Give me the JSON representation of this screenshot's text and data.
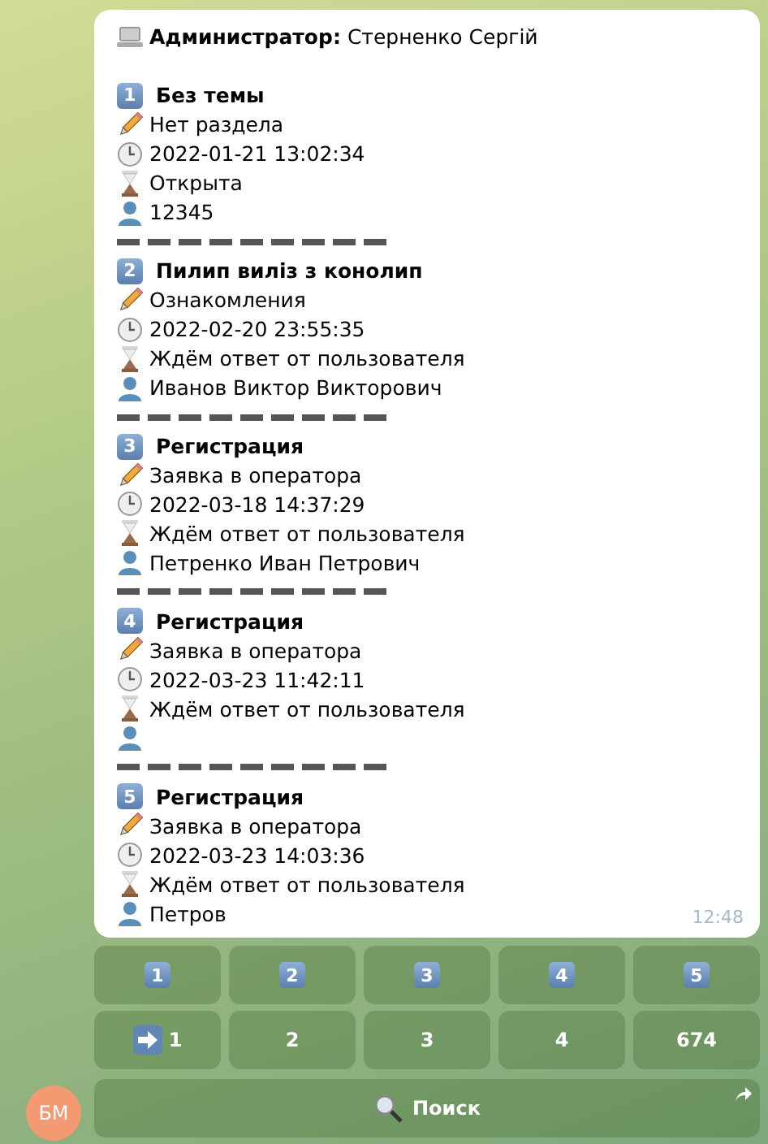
{
  "message": {
    "header": "**Администратор:** Стерненко Сергій",
    "time": "12:48",
    "tickets": [
      {
        "number": "1",
        "title": "Без темы",
        "section": "Нет раздела",
        "date": "2022-01-21 13:02:34",
        "status": "Открыта",
        "user": "12345"
      },
      {
        "number": "2",
        "title": "Пилип виліз з конолип",
        "section": "Ознакомления",
        "date": "2022-02-20 23:55:35",
        "status": "Ждём ответ от пользователя",
        "user": "Иванов Виктор Викторович"
      },
      {
        "number": "3",
        "title": "Регистрация",
        "section": "Заявка в оператора",
        "date": "2022-03-18 14:37:29",
        "status": "Ждём ответ от пользователя",
        "user": "Петренко Иван Петрович"
      },
      {
        "number": "4",
        "title": "Регистрация",
        "section": "Заявка в оператора",
        "date": "2022-03-23 11:42:11",
        "status": "Ждём ответ от пользователя"
      },
      {
        "number": "5",
        "title": "Регистрация",
        "section": "Заявка в оператора",
        "date": "2022-03-23 14:03:36",
        "status": "Ждём ответ от пользователя",
        "user": "Петров"
      }
    ]
  },
  "keyboard": {
    "ticket_buttons": [
      "1",
      "2",
      "3",
      "4",
      "5"
    ],
    "pages": [
      {
        "label": "1",
        "selected": true
      },
      {
        "label": "2",
        "selected": false
      },
      {
        "label": "3",
        "selected": false
      },
      {
        "label": "4",
        "selected": false
      },
      {
        "label": "674",
        "selected": false
      }
    ],
    "search_button": "Поиск"
  },
  "avatar": "БМ"
}
